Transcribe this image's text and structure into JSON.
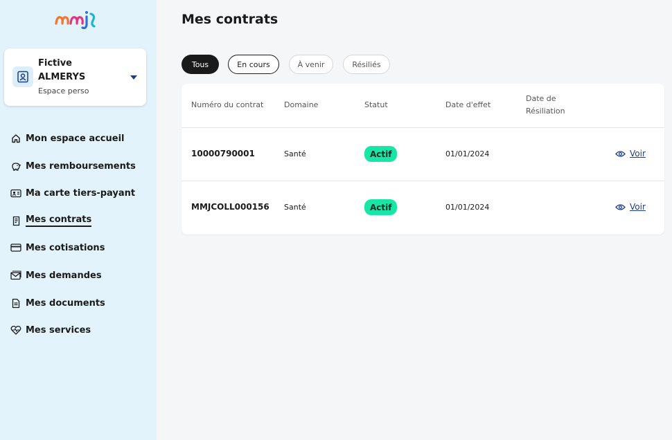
{
  "sidebar": {
    "profile": {
      "first_name": "Fictive",
      "last_name": "ALMERYS",
      "space": "Espace perso"
    },
    "items": [
      {
        "label": "Mon espace accueil",
        "icon": "home-icon"
      },
      {
        "label": "Mes remboursements",
        "icon": "piggy-bank-icon"
      },
      {
        "label": "Ma carte tiers-payant",
        "icon": "id-card-icon"
      },
      {
        "label": "Mes contrats",
        "icon": "contract-icon",
        "active": true
      },
      {
        "label": "Mes cotisations",
        "icon": "credit-card-icon"
      },
      {
        "label": "Mes demandes",
        "icon": "mail-icon"
      },
      {
        "label": "Mes documents",
        "icon": "document-icon"
      },
      {
        "label": "Mes services",
        "icon": "heart-pulse-icon"
      }
    ]
  },
  "main": {
    "title": "Mes contrats",
    "filters": [
      "Tous",
      "En cours",
      "À venir",
      "Résiliés"
    ],
    "table": {
      "headers": [
        "Numéro du contrat",
        "Domaine",
        "Statut",
        "Date d'effet",
        "Date de",
        "Résiliation"
      ],
      "rows": [
        {
          "number": "10000790001",
          "domain": "Santé",
          "status": "Actif",
          "date": "01/01/2024",
          "action": "Voir"
        },
        {
          "number": "MMJCOLL000156",
          "domain": "Santé",
          "status": "Actif",
          "date": "01/01/2024",
          "action": "Voir"
        }
      ]
    }
  },
  "colors": {
    "sidebar_bg": "#e3f3fc",
    "status_green": "#19e6a6",
    "link_blue": "#1a3c8c"
  }
}
